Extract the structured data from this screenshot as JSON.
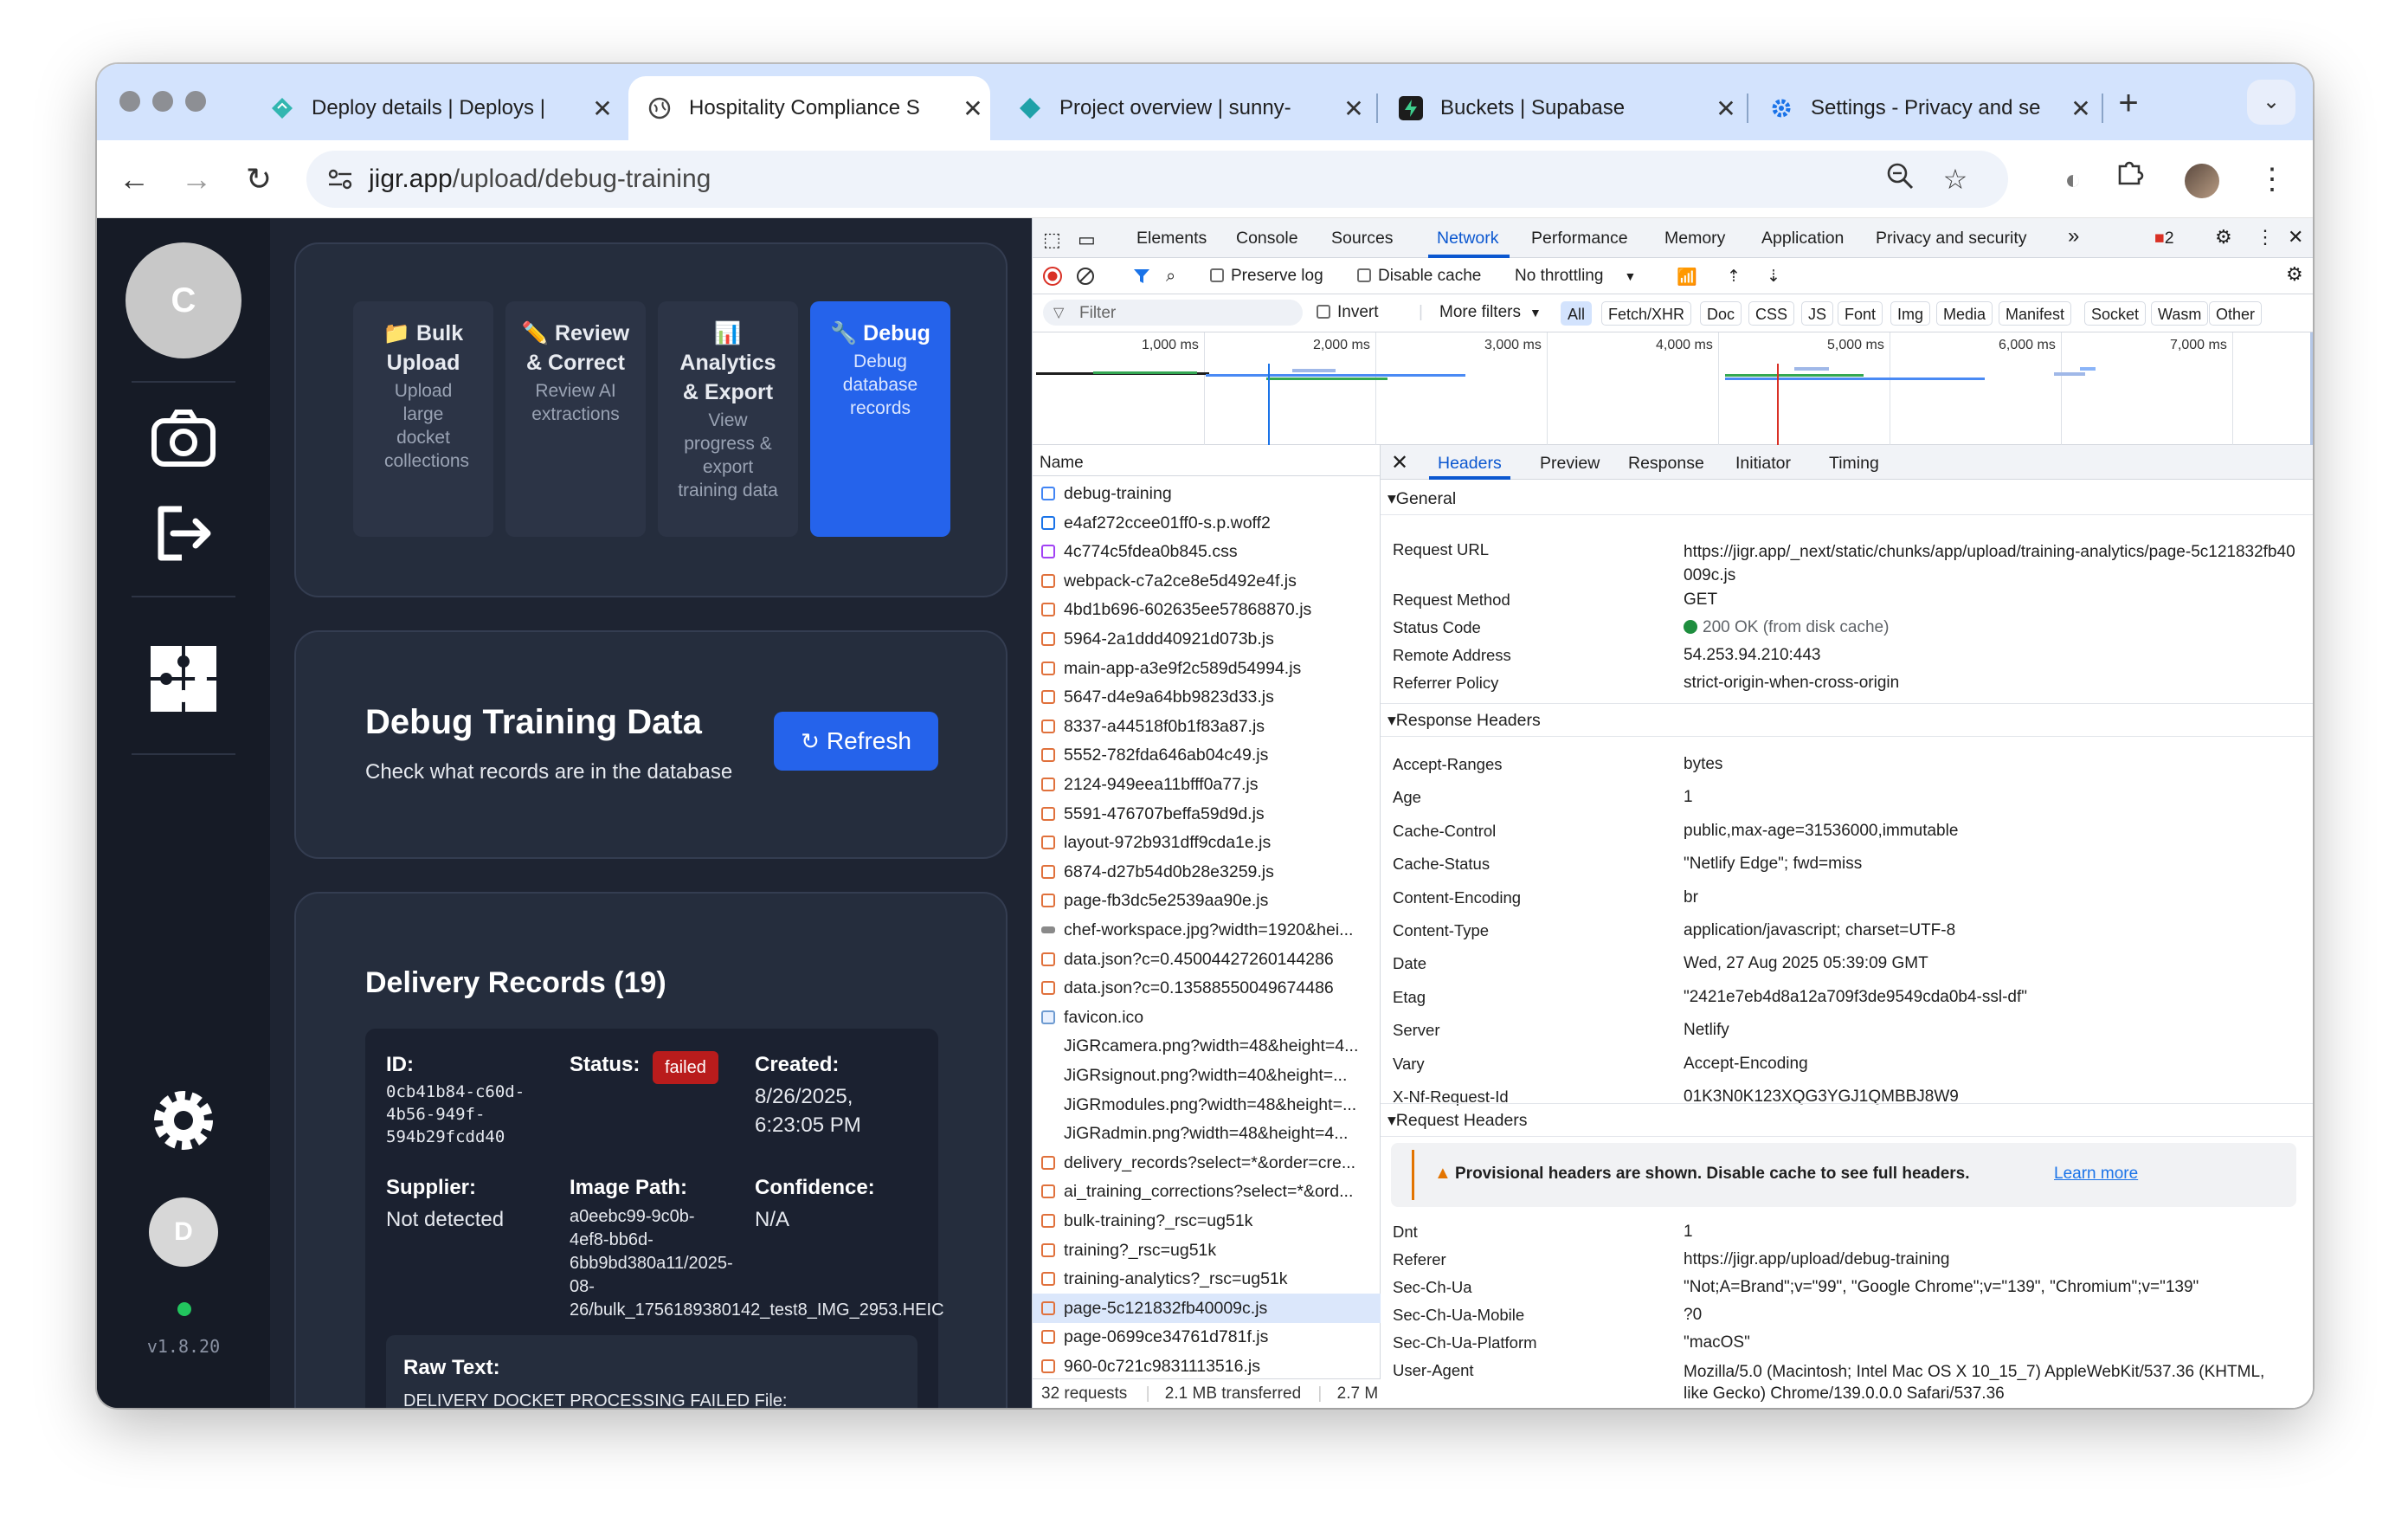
{
  "browser": {
    "tabs": [
      {
        "title": "Deploy details | Deploys |",
        "close": "✕"
      },
      {
        "title": "Hospitality Compliance S",
        "close": "✕"
      },
      {
        "title": "Project overview | sunny-",
        "close": "✕"
      },
      {
        "title": "Buckets | Supabase",
        "close": "✕"
      },
      {
        "title": "Settings - Privacy and se",
        "close": "✕"
      }
    ],
    "new_tab": "+",
    "url_host": "jigr.app",
    "url_path": "/upload/debug-training"
  },
  "app": {
    "rail": {
      "avatar_initial": "C",
      "user_initial": "D",
      "version": "v1.8.20"
    },
    "quick_actions": [
      {
        "title": "📁 Bulk Upload",
        "desc": "Upload large docket collections"
      },
      {
        "title": "✏️ Review & Correct",
        "desc": "Review AI extractions"
      },
      {
        "title": "📊 Analytics & Export",
        "desc": "View progress & export training data"
      },
      {
        "title": "🔧 Debug",
        "desc": "Debug database records"
      }
    ],
    "debug": {
      "title": "Debug Training Data",
      "subtitle": "Check what records are in the database",
      "refresh_label": "Refresh"
    },
    "records": {
      "title": "Delivery Records (19)",
      "id_label": "ID:",
      "id_value": "0cb41b84-c60d-4b56-949f-594b29fcdd40",
      "status_label": "Status:",
      "status_value": "failed",
      "created_label": "Created:",
      "created_value": "8/26/2025, 6:23:05 PM",
      "supplier_label": "Supplier:",
      "supplier_value": "Not detected",
      "image_path_label": "Image Path:",
      "image_path_value": "a0eebc99-9c0b-4ef8-bb6d-6bb9bd380a11/2025-08-26/bulk_1756189380142_test8_IMG_2953.HEIC",
      "confidence_label": "Confidence:",
      "confidence_value": "N/A",
      "raw_text_label": "Raw Text:",
      "raw_text_value": "DELIVERY DOCKET PROCESSING FAILED File:"
    }
  },
  "devtools": {
    "tabs": [
      "Elements",
      "Console",
      "Sources",
      "Network",
      "Performance",
      "Memory",
      "Application",
      "Privacy and security"
    ],
    "more": "»",
    "issues_count": "2",
    "toolbar": {
      "preserve_log": "Preserve log",
      "disable_cache": "Disable cache",
      "throttling": "No throttling"
    },
    "filter": {
      "placeholder": "Filter",
      "invert": "Invert",
      "more_filters": "More filters",
      "chips": [
        "All",
        "Fetch/XHR",
        "Doc",
        "CSS",
        "JS",
        "Font",
        "Img",
        "Media",
        "Manifest",
        "Socket",
        "Wasm",
        "Other"
      ]
    },
    "timeline_ticks": [
      "1,000 ms",
      "2,000 ms",
      "3,000 ms",
      "4,000 ms",
      "5,000 ms",
      "6,000 ms",
      "7,000 ms"
    ],
    "list_header": "Name",
    "requests": [
      {
        "name": "debug-training",
        "type": "doc"
      },
      {
        "name": "e4af272ccee01ff0-s.p.woff2",
        "type": "font"
      },
      {
        "name": "4c774c5fdea0b845.css",
        "type": "css"
      },
      {
        "name": "webpack-c7a2ce8e5d492e4f.js",
        "type": "js"
      },
      {
        "name": "4bd1b696-602635ee57868870.js",
        "type": "js"
      },
      {
        "name": "5964-2a1ddd40921d073b.js",
        "type": "js"
      },
      {
        "name": "main-app-a3e9f2c589d54994.js",
        "type": "js"
      },
      {
        "name": "5647-d4e9a64bb9823d33.js",
        "type": "js"
      },
      {
        "name": "8337-a44518f0b1f83a87.js",
        "type": "js"
      },
      {
        "name": "5552-782fda646ab04c49.js",
        "type": "js"
      },
      {
        "name": "2124-949eea11bfff0a77.js",
        "type": "js"
      },
      {
        "name": "5591-476707beffa59d9d.js",
        "type": "js"
      },
      {
        "name": "layout-972b931dff9cda1e.js",
        "type": "js"
      },
      {
        "name": "6874-d27b54d0b28e3259.js",
        "type": "js"
      },
      {
        "name": "page-fb3dc5e2539aa90e.js",
        "type": "js"
      },
      {
        "name": "chef-workspace.jpg?width=1920&hei...",
        "type": "img"
      },
      {
        "name": "data.json?c=0.45004427260144286",
        "type": "xhr"
      },
      {
        "name": "data.json?c=0.13588550049674486",
        "type": "xhr"
      },
      {
        "name": "favicon.ico",
        "type": "fav"
      },
      {
        "name": "JiGRcamera.png?width=48&height=4...",
        "type": "none"
      },
      {
        "name": "JiGRsignout.png?width=40&height=...",
        "type": "none"
      },
      {
        "name": "JiGRmodules.png?width=48&height=...",
        "type": "none"
      },
      {
        "name": "JiGRadmin.png?width=48&height=4...",
        "type": "none"
      },
      {
        "name": "delivery_records?select=*&order=cre...",
        "type": "xhr"
      },
      {
        "name": "ai_training_corrections?select=*&ord...",
        "type": "xhr"
      },
      {
        "name": "bulk-training?_rsc=ug51k",
        "type": "js"
      },
      {
        "name": "training?_rsc=ug51k",
        "type": "js"
      },
      {
        "name": "training-analytics?_rsc=ug51k",
        "type": "js"
      },
      {
        "name": "page-5c121832fb40009c.js",
        "type": "js",
        "selected": true
      },
      {
        "name": "page-0699ce34761d781f.js",
        "type": "js"
      },
      {
        "name": "960-0c721c9831113516.js",
        "type": "js"
      }
    ],
    "footer": {
      "requests": "32 requests",
      "transferred": "2.1 MB transferred",
      "resources": "2.7 M"
    },
    "detail_tabs": [
      "Headers",
      "Preview",
      "Response",
      "Initiator",
      "Timing"
    ],
    "general": {
      "title": "General",
      "rows": [
        {
          "k": "Request URL",
          "v": "https://jigr.app/_next/static/chunks/app/upload/training-analytics/page-5c121832fb40009c.js"
        },
        {
          "k": "Request Method",
          "v": "GET"
        },
        {
          "k": "Status Code",
          "v": "200 OK (from disk cache)"
        },
        {
          "k": "Remote Address",
          "v": "54.253.94.210:443"
        },
        {
          "k": "Referrer Policy",
          "v": "strict-origin-when-cross-origin"
        }
      ]
    },
    "response_headers": {
      "title": "Response Headers",
      "rows": [
        {
          "k": "Accept-Ranges",
          "v": "bytes"
        },
        {
          "k": "Age",
          "v": "1"
        },
        {
          "k": "Cache-Control",
          "v": "public,max-age=31536000,immutable"
        },
        {
          "k": "Cache-Status",
          "v": "\"Netlify Edge\"; fwd=miss"
        },
        {
          "k": "Content-Encoding",
          "v": "br"
        },
        {
          "k": "Content-Type",
          "v": "application/javascript; charset=UTF-8"
        },
        {
          "k": "Date",
          "v": "Wed, 27 Aug 2025 05:39:09 GMT"
        },
        {
          "k": "Etag",
          "v": "\"2421e7eb4d8a12a709f3de9549cda0b4-ssl-df\""
        },
        {
          "k": "Server",
          "v": "Netlify"
        },
        {
          "k": "Vary",
          "v": "Accept-Encoding"
        },
        {
          "k": "X-Nf-Request-Id",
          "v": "01K3N0K123XQG3YGJ1QMBBJ8W9"
        }
      ]
    },
    "request_headers": {
      "title": "Request Headers",
      "warning": "Provisional headers are shown. Disable cache to see full headers.",
      "learn_more": "Learn more",
      "rows": [
        {
          "k": "Dnt",
          "v": "1"
        },
        {
          "k": "Referer",
          "v": "https://jigr.app/upload/debug-training"
        },
        {
          "k": "Sec-Ch-Ua",
          "v": "\"Not;A=Brand\";v=\"99\", \"Google Chrome\";v=\"139\", \"Chromium\";v=\"139\""
        },
        {
          "k": "Sec-Ch-Ua-Mobile",
          "v": "?0"
        },
        {
          "k": "Sec-Ch-Ua-Platform",
          "v": "\"macOS\""
        },
        {
          "k": "User-Agent",
          "v": "Mozilla/5.0 (Macintosh; Intel Mac OS X 10_15_7) AppleWebKit/537.36 (KHTML, like Gecko) Chrome/139.0.0.0 Safari/537.36"
        }
      ]
    }
  }
}
